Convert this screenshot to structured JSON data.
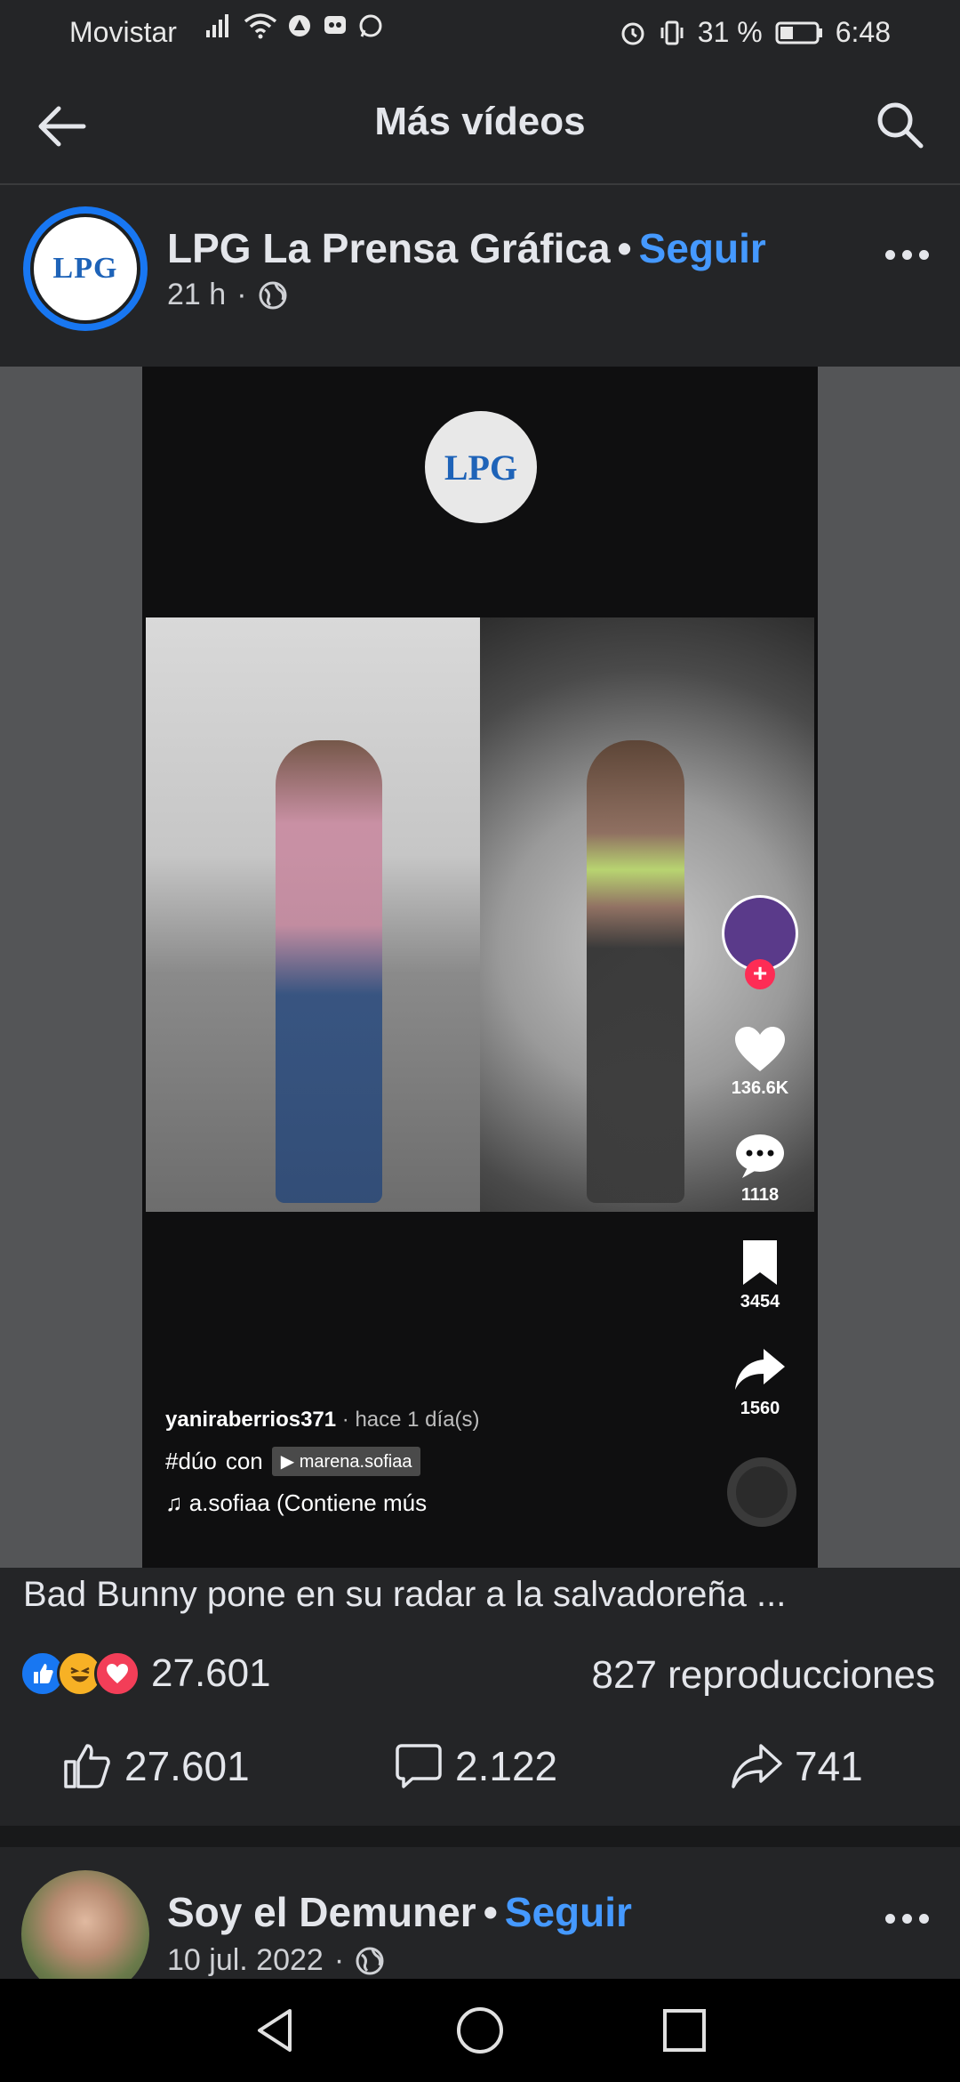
{
  "status_bar": {
    "carrier": "Movistar",
    "battery": "31 %",
    "time": "6:48"
  },
  "header": {
    "title": "Más vídeos",
    "back_icon": "arrow-left-icon",
    "search_icon": "search-icon"
  },
  "post1": {
    "page_name": "LPG La Prensa Gráfica",
    "separator": "•",
    "follow_label": "Seguir",
    "time": "21 h",
    "dot": "·",
    "audience_icon": "globe-icon",
    "avatar_text": "LPG",
    "video": {
      "logo_text": "LPG",
      "likes": "136.6K",
      "comments": "1118",
      "saves": "3454",
      "shares": "1560",
      "username": "yaniraberrios371",
      "ago": " · hace 1 día(s)",
      "tag": "#dúo",
      "tag_con": "con",
      "chip": "▶ marena.sofiaa",
      "music": "♫ a.sofiaa (Contiene mús"
    },
    "caption": "Bad Bunny pone en su radar a la salvadoreña ...",
    "reactions_count": "27.601",
    "views": "827 reproducciones",
    "actions": {
      "like_count": "27.601",
      "comment_count": "2.122",
      "share_count": "741"
    }
  },
  "post2": {
    "page_name": "Soy el Demuner",
    "separator": "•",
    "follow_label": "Seguir",
    "date": "10 jul. 2022",
    "dot": "·"
  },
  "colors": {
    "background": "#242527",
    "link_blue": "#4599ff",
    "text": "#e4e6eb",
    "tiktok_red": "#fe2c55"
  }
}
